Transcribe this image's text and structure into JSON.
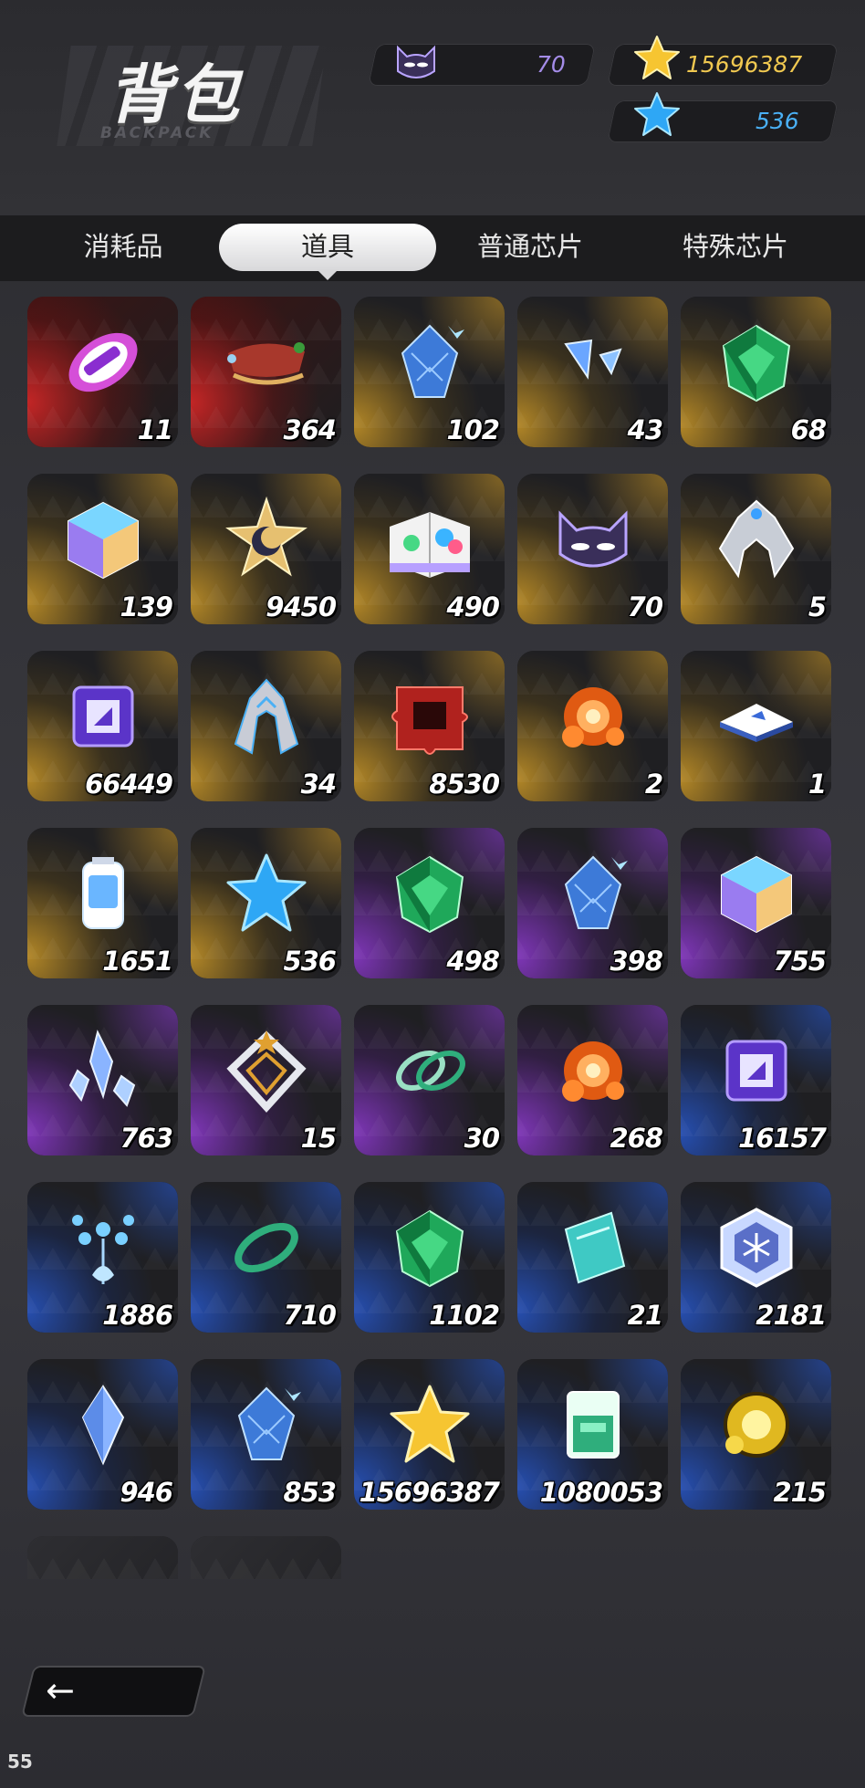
{
  "header": {
    "title": "背包",
    "subtitle": "BACKPACK",
    "resources": [
      {
        "icon": "cat-mask-icon",
        "value": "70",
        "color": "#a48ce8"
      },
      {
        "icon": "gold-star-icon",
        "value": "15696387",
        "color": "#f0c850"
      },
      {
        "icon": "blue-star-icon",
        "value": "536",
        "color": "#4ab0f5"
      }
    ]
  },
  "tabs": [
    {
      "label": "消耗品",
      "active": false
    },
    {
      "label": "道具",
      "active": true
    },
    {
      "label": "普通芯片",
      "active": false
    },
    {
      "label": "特殊芯片",
      "active": false
    }
  ],
  "items": [
    {
      "icon": "capsule-icon",
      "count": "11",
      "rarity": "red"
    },
    {
      "icon": "sleigh-icon",
      "count": "364",
      "rarity": "red"
    },
    {
      "icon": "blue-crystal-pinecone-icon",
      "count": "102",
      "rarity": "gold"
    },
    {
      "icon": "blue-shards-icon",
      "count": "43",
      "rarity": "gold"
    },
    {
      "icon": "green-gem-icon",
      "count": "68",
      "rarity": "gold"
    },
    {
      "icon": "prism-cube-icon",
      "count": "139",
      "rarity": "gold"
    },
    {
      "icon": "moon-star-badge-icon",
      "count": "9450",
      "rarity": "gold"
    },
    {
      "icon": "paint-book-icon",
      "count": "490",
      "rarity": "gold"
    },
    {
      "icon": "cat-mask-icon",
      "count": "70",
      "rarity": "gold"
    },
    {
      "icon": "silver-crest-icon",
      "count": "5",
      "rarity": "gold"
    },
    {
      "icon": "purple-chip-icon",
      "count": "66449",
      "rarity": "gold"
    },
    {
      "icon": "armor-wing-icon",
      "count": "34",
      "rarity": "gold"
    },
    {
      "icon": "red-puzzle-icon",
      "count": "8530",
      "rarity": "gold"
    },
    {
      "icon": "orange-orb-cluster-icon",
      "count": "2",
      "rarity": "gold"
    },
    {
      "icon": "blue-ticket-icon",
      "count": "1",
      "rarity": "gold"
    },
    {
      "icon": "bottle-icon",
      "count": "1651",
      "rarity": "gold"
    },
    {
      "icon": "blue-star-icon",
      "count": "536",
      "rarity": "gold"
    },
    {
      "icon": "green-gem-icon",
      "count": "498",
      "rarity": "purple"
    },
    {
      "icon": "blue-crystal-pinecone-icon",
      "count": "398",
      "rarity": "purple"
    },
    {
      "icon": "prism-cube-icon",
      "count": "755",
      "rarity": "purple"
    },
    {
      "icon": "crystal-cluster-icon",
      "count": "763",
      "rarity": "purple"
    },
    {
      "icon": "star-crest-icon",
      "count": "15",
      "rarity": "purple"
    },
    {
      "icon": "twin-ring-icon",
      "count": "30",
      "rarity": "purple"
    },
    {
      "icon": "orange-orb-cluster-icon",
      "count": "268",
      "rarity": "purple"
    },
    {
      "icon": "purple-chip-icon",
      "count": "16157",
      "rarity": "blue"
    },
    {
      "icon": "crystal-flower-icon",
      "count": "1886",
      "rarity": "blue"
    },
    {
      "icon": "green-ring-icon",
      "count": "710",
      "rarity": "blue"
    },
    {
      "icon": "green-gem-icon",
      "count": "1102",
      "rarity": "blue"
    },
    {
      "icon": "cyan-card-icon",
      "count": "21",
      "rarity": "blue"
    },
    {
      "icon": "hex-snowflake-icon",
      "count": "2181",
      "rarity": "blue"
    },
    {
      "icon": "blue-diamond-icon",
      "count": "946",
      "rarity": "blue"
    },
    {
      "icon": "blue-crystal-pinecone-icon",
      "count": "853",
      "rarity": "blue"
    },
    {
      "icon": "gold-star-icon",
      "count": "15696387",
      "rarity": "blue"
    },
    {
      "icon": "glass-box-icon",
      "count": "1080053",
      "rarity": "blue"
    },
    {
      "icon": "gold-orb-icon",
      "count": "215",
      "rarity": "blue"
    },
    {
      "icon": "white-rock-icon",
      "count": "",
      "rarity": "dark"
    },
    {
      "icon": "unknown-icon",
      "count": "",
      "rarity": "dark"
    }
  ],
  "footer": {
    "back_icon": "back-arrow-icon",
    "fps": "55"
  }
}
